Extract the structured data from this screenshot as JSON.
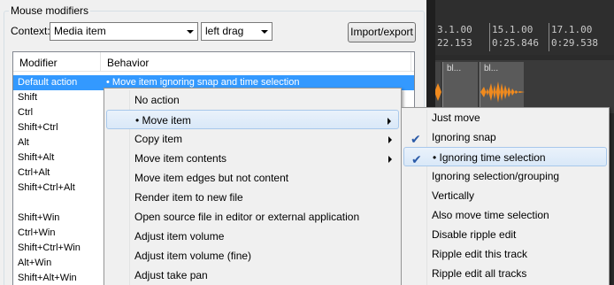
{
  "group_title": "Mouse modifiers",
  "context": {
    "label": "Context:",
    "selected": "Media item",
    "action_selected": "left drag"
  },
  "import_export_label": "Import/export",
  "list": {
    "columns": [
      "Modifier",
      "Behavior"
    ],
    "rows": [
      {
        "modifier": "Default action",
        "behavior": "• Move item ignoring snap and time selection",
        "selected": true
      },
      {
        "modifier": "Shift",
        "behavior": ""
      },
      {
        "modifier": "Ctrl",
        "behavior": ""
      },
      {
        "modifier": "Shift+Ctrl",
        "behavior": ""
      },
      {
        "modifier": "Alt",
        "behavior": ""
      },
      {
        "modifier": "Shift+Alt",
        "behavior": ""
      },
      {
        "modifier": "Ctrl+Alt",
        "behavior": ""
      },
      {
        "modifier": "Shift+Ctrl+Alt",
        "behavior": ""
      },
      {
        "modifier": "",
        "behavior": ""
      },
      {
        "modifier": "Shift+Win",
        "behavior": ""
      },
      {
        "modifier": "Ctrl+Win",
        "behavior": ""
      },
      {
        "modifier": "Shift+Ctrl+Win",
        "behavior": ""
      },
      {
        "modifier": "Alt+Win",
        "behavior": ""
      },
      {
        "modifier": "Shift+Alt+Win",
        "behavior": ""
      }
    ]
  },
  "menu1": {
    "items": [
      {
        "label": "No action",
        "submenu": false
      },
      {
        "label": "• Move item",
        "submenu": true,
        "highlighted": true
      },
      {
        "label": "Copy item",
        "submenu": true
      },
      {
        "label": "Move item contents",
        "submenu": true
      },
      {
        "label": "Move item edges but not content",
        "submenu": false
      },
      {
        "label": "Render item to new file",
        "submenu": false
      },
      {
        "label": "Open source file in editor or external application",
        "submenu": false
      },
      {
        "label": "Adjust item volume",
        "submenu": false
      },
      {
        "label": "Adjust item volume (fine)",
        "submenu": false
      },
      {
        "label": "Adjust take pan",
        "submenu": false
      }
    ]
  },
  "menu2": {
    "items": [
      {
        "label": "Just move",
        "checked": false
      },
      {
        "label": "Ignoring snap",
        "checked": true
      },
      {
        "label": "• Ignoring time selection",
        "checked": true,
        "highlighted": true
      },
      {
        "label": "Ignoring selection/grouping",
        "checked": false
      },
      {
        "label": "Vertically",
        "checked": false
      },
      {
        "label": "Also move time selection",
        "checked": false
      },
      {
        "label": "Disable ripple edit",
        "checked": false
      },
      {
        "label": "Ripple edit this track",
        "checked": false
      },
      {
        "label": "Ripple edit all tracks",
        "checked": false
      }
    ]
  },
  "arrange": {
    "markers": [
      {
        "bar": "3.1.00",
        "time": "22.153"
      },
      {
        "bar": "15.1.00",
        "time": "0:25.846"
      },
      {
        "bar": "17.1.00",
        "time": "0:29.538"
      }
    ],
    "item_names": [
      "bl...",
      "bl..."
    ],
    "waveform_color": "#f08a1e"
  },
  "icons": {
    "check": "check-icon",
    "submenu": "submenu-arrow-icon",
    "dropdown": "chevron-down-icon"
  }
}
